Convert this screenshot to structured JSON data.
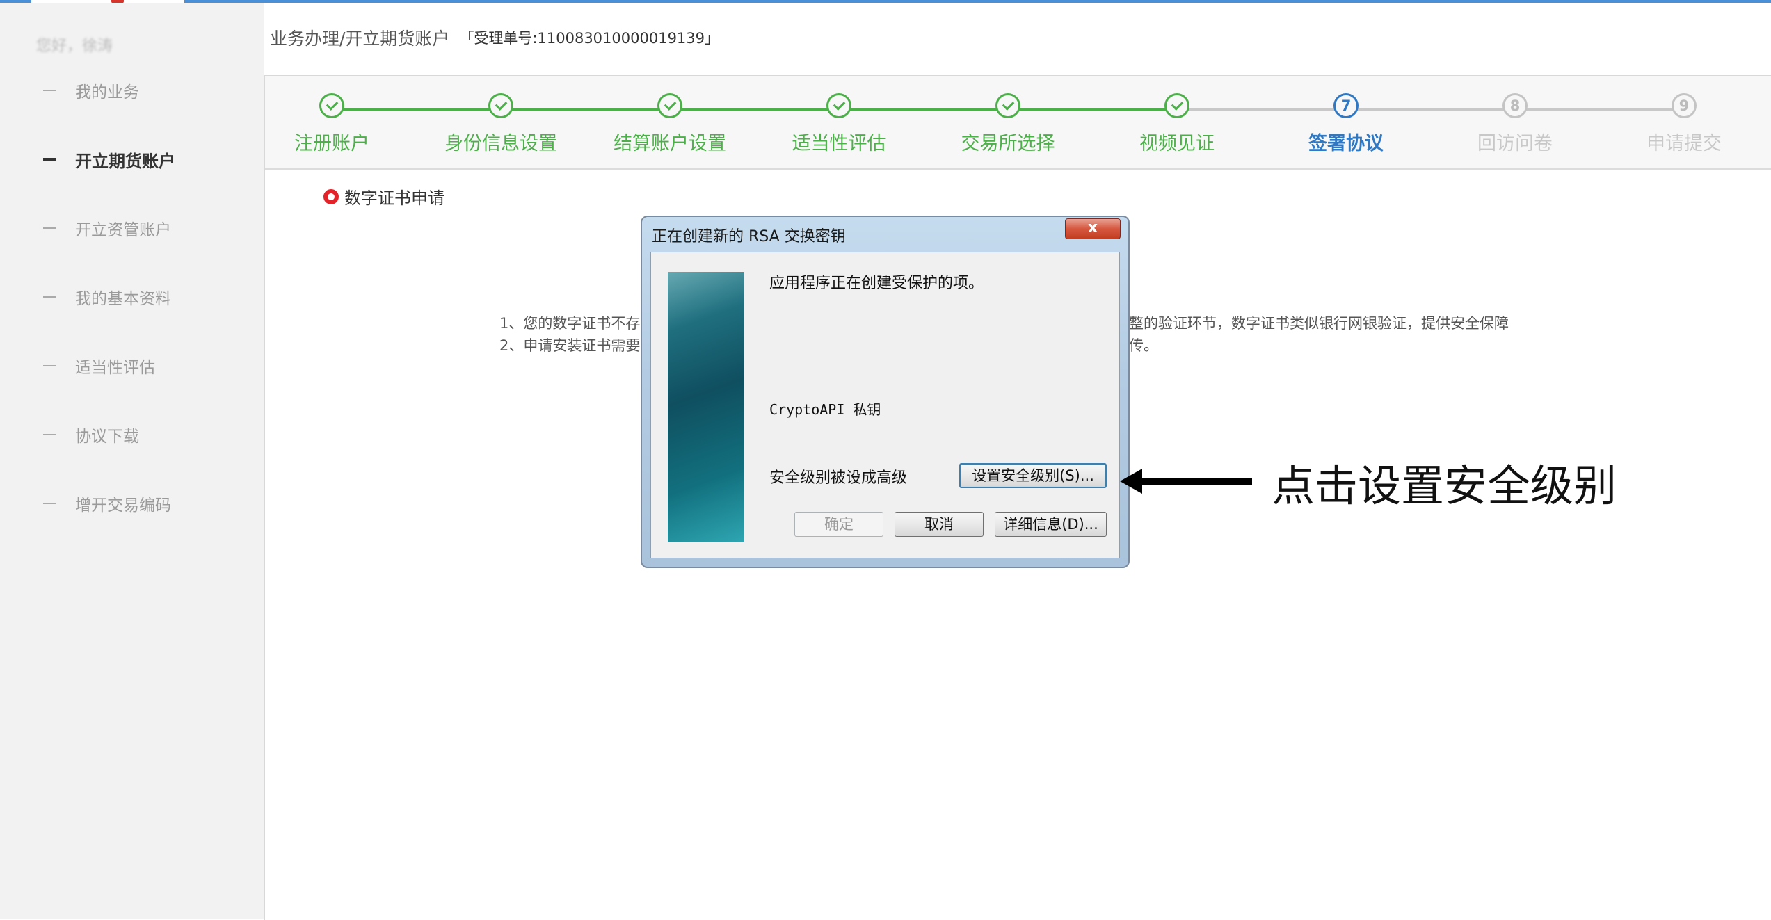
{
  "sidebar": {
    "greeting": "您好，徐涛",
    "items": [
      {
        "label": "我的业务",
        "active": false
      },
      {
        "label": "开立期货账户",
        "active": true
      },
      {
        "label": "开立资管账户",
        "active": false
      },
      {
        "label": "我的基本资料",
        "active": false
      },
      {
        "label": "适当性评估",
        "active": false
      },
      {
        "label": "协议下载",
        "active": false
      },
      {
        "label": "增开交易编码",
        "active": false
      }
    ]
  },
  "header": {
    "breadcrumb": "业务办理/开立期货账户",
    "accept_no": "「受理单号:110083010000019139」"
  },
  "steps": [
    {
      "label": "注册账户",
      "status": "done",
      "num": ""
    },
    {
      "label": "身份信息设置",
      "status": "done",
      "num": ""
    },
    {
      "label": "结算账户设置",
      "status": "done",
      "num": ""
    },
    {
      "label": "适当性评估",
      "status": "done",
      "num": ""
    },
    {
      "label": "交易所选择",
      "status": "done",
      "num": ""
    },
    {
      "label": "视频见证",
      "status": "done",
      "num": ""
    },
    {
      "label": "签署协议",
      "status": "current",
      "num": "7"
    },
    {
      "label": "回访问卷",
      "status": "todo",
      "num": "8"
    },
    {
      "label": "申请提交",
      "status": "todo",
      "num": "9"
    }
  ],
  "content": {
    "section_title": "数字证书申请",
    "notice1_left": "1、您的数字证书不存",
    "notice1_right": "整的验证环节，数字证书类似银行网银验证，提供安全保障",
    "notice2_left": "2、申请安装证书需要",
    "notice2_right": "传。"
  },
  "dialog": {
    "title": "正在创建新的 RSA 交换密钥",
    "close_label": "x",
    "message": "应用程序正在创建受保护的项。",
    "key_name": "CryptoAPI 私钥",
    "security_text": "安全级别被设成高级",
    "set_security_button": "设置安全级别(S)...",
    "ok_button": "确定",
    "cancel_button": "取消",
    "details_button": "详细信息(D)..."
  },
  "annotation": {
    "callout_text": "点击设置安全级别"
  },
  "colors": {
    "done_green": "#4cb048",
    "current_blue": "#2f78c4",
    "todo_gray": "#c4c4c4",
    "top_accent": "#4a90d9"
  }
}
